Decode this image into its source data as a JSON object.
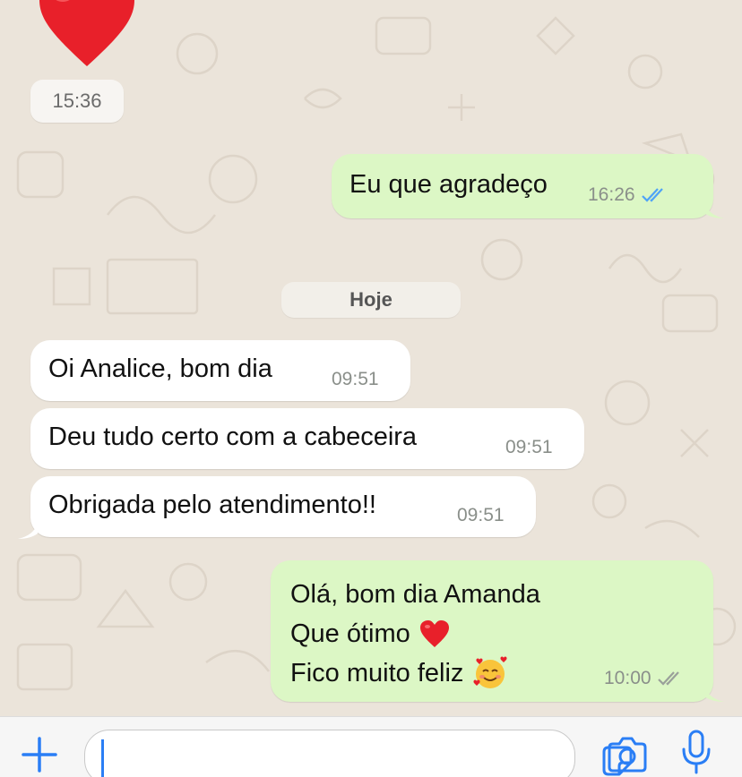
{
  "chat": {
    "prev_time": "15:36",
    "messages_top": {
      "outgoing_1": {
        "text": "Eu que agradeço",
        "time": "16:26",
        "status": "read-blue-double-check"
      }
    },
    "date_separator": "Hoje",
    "incoming": [
      {
        "text": "Oi Analice, bom dia",
        "time": "09:51"
      },
      {
        "text": "Deu tudo certo com a cabeceira",
        "time": "09:51"
      },
      {
        "text": "Obrigada pelo atendimento!!",
        "time": "09:51"
      }
    ],
    "outgoing_2": {
      "line1": "Olá, bom dia Amanda",
      "line2": "Que ótimo",
      "line2_emoji": "red-heart-icon",
      "line3": "Fico muito feliz",
      "line3_emoji": "smiling-face-with-hearts-icon",
      "time": "10:00",
      "status": "delivered-grey-double-check"
    }
  },
  "input_bar": {
    "placeholder": "",
    "icons": [
      "plus-icon",
      "sticker-icon",
      "camera-icon",
      "microphone-icon"
    ]
  },
  "colors": {
    "accent": "#2a7ef5",
    "outgoing_bubble": "#dcf7c5",
    "incoming_bubble": "#ffffff",
    "wallpaper": "#ebe4da",
    "read_check": "#4fa3f7"
  }
}
